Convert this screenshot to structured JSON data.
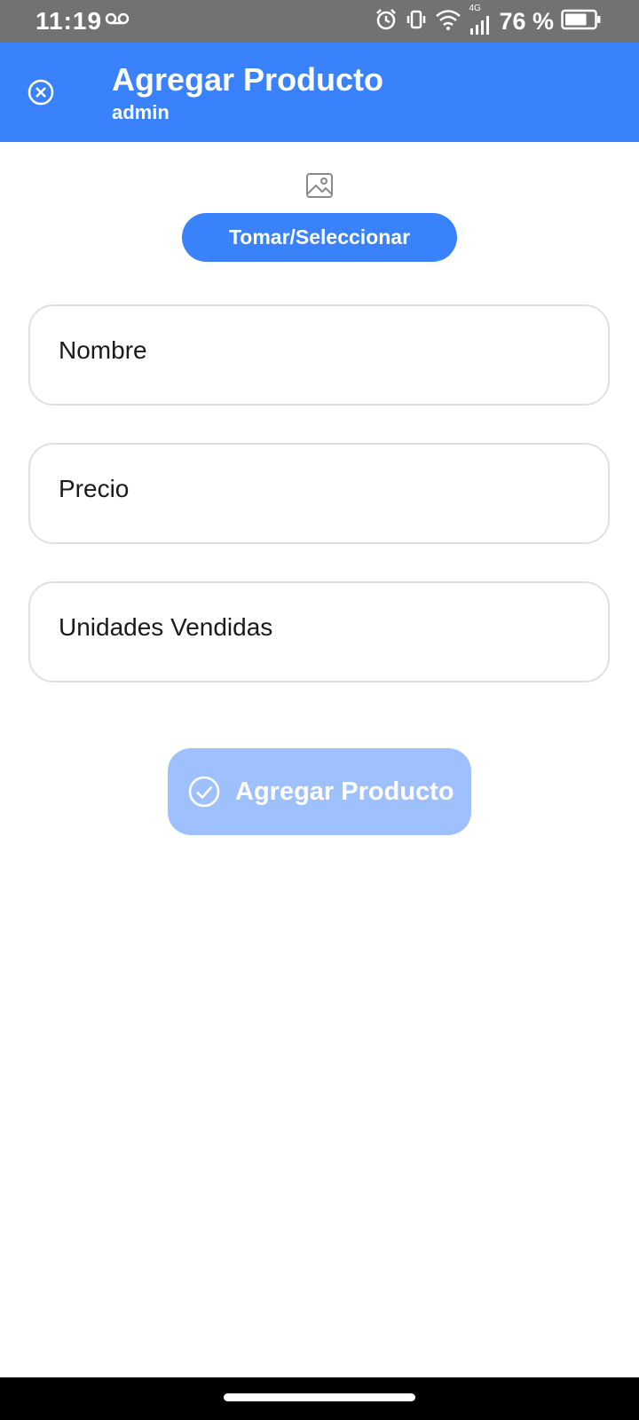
{
  "status_bar": {
    "time": "11:19",
    "network_label": "4G",
    "battery_percent": "76 %",
    "battery_level": 0.76,
    "icons": [
      "voicemail-icon",
      "alarm-icon",
      "vibrate-icon",
      "wifi-icon",
      "signal-icon",
      "battery-icon"
    ]
  },
  "app_bar": {
    "title": "Agregar Producto",
    "subtitle": "admin",
    "close_icon": "close-circle-icon",
    "color": "#3a82fb"
  },
  "image_picker": {
    "placeholder_icon": "image-icon",
    "button_label": "Tomar/Seleccionar"
  },
  "form": {
    "fields": [
      {
        "name": "nombre",
        "placeholder": "Nombre",
        "value": ""
      },
      {
        "name": "precio",
        "placeholder": "Precio",
        "value": ""
      },
      {
        "name": "unidades-vendidas",
        "placeholder": "Unidades Vendidas",
        "value": ""
      }
    ],
    "submit_label": "Agregar Producto",
    "submit_icon": "check-circle-icon",
    "submit_color": "#9ec0fc"
  }
}
